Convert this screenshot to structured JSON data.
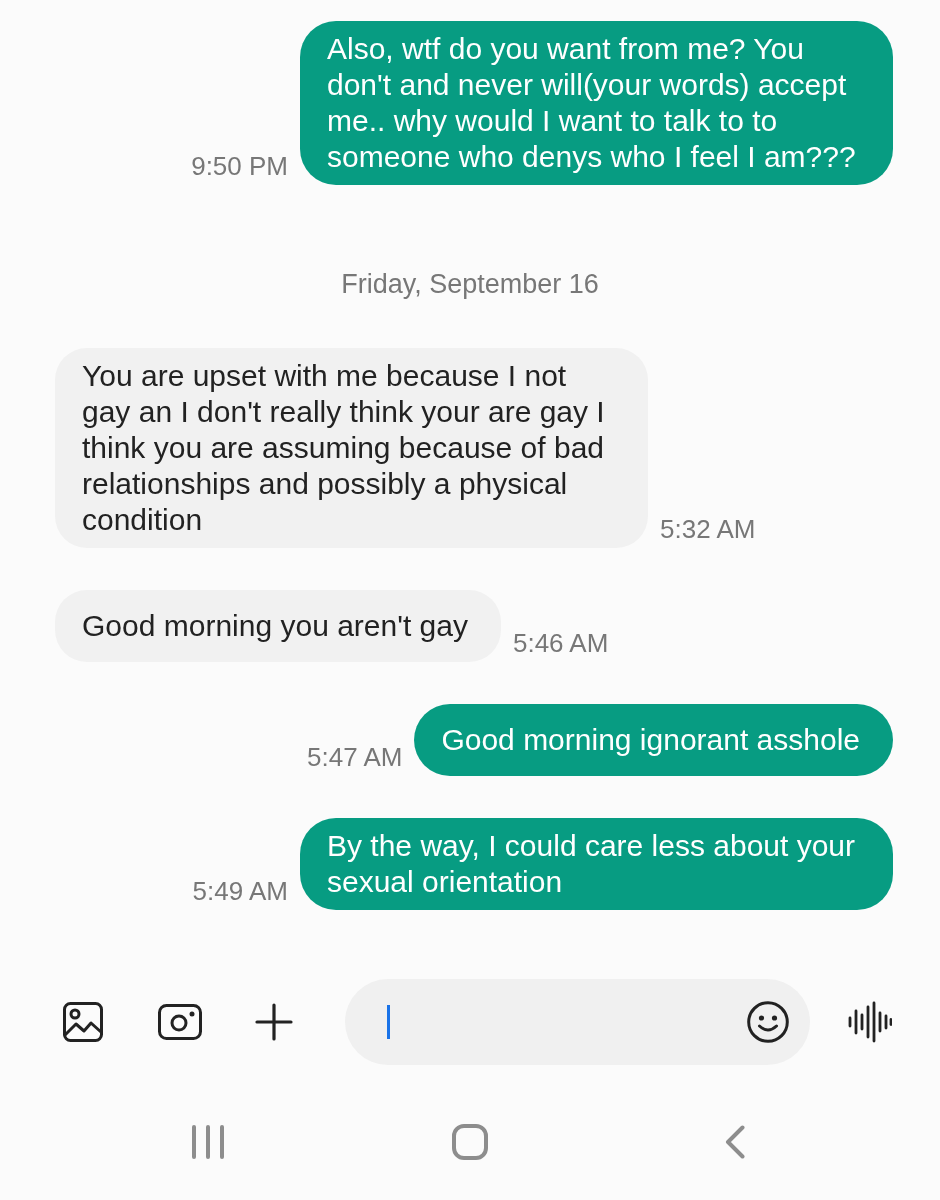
{
  "messages": [
    {
      "kind": "sent",
      "text": "Also, wtf do you want from me? You don't and never will(your words) accept me.. why would I want to talk to to someone who denys who I feel I am???",
      "time": "9:50 PM"
    },
    {
      "kind": "date",
      "text": "Friday, September 16"
    },
    {
      "kind": "received",
      "text": "You are upset with me because I not gay an I don't really think your are gay I think you are assuming because of bad relationships and possibly a physical condition",
      "time": "5:32 AM"
    },
    {
      "kind": "received",
      "text": "Good morning you aren't gay",
      "time": "5:46 AM"
    },
    {
      "kind": "sent",
      "text": "Good morning ignorant asshole",
      "time": "5:47 AM"
    },
    {
      "kind": "sent",
      "text": "By the way, I could care less about your sexual orientation",
      "time": "5:49 AM"
    }
  ],
  "composer": {
    "focused": true
  }
}
